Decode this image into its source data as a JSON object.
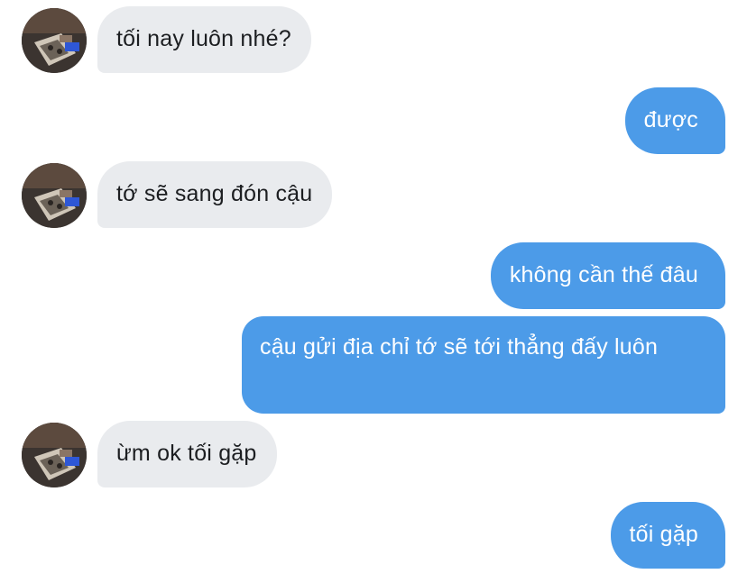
{
  "conversation": {
    "messages": [
      {
        "sender": "them",
        "text": "tối nay luôn nhé?"
      },
      {
        "sender": "me",
        "text": "được"
      },
      {
        "sender": "them",
        "text": "tớ sẽ sang đón cậu"
      },
      {
        "sender": "me",
        "text": "không cần thế đâu"
      },
      {
        "sender": "me",
        "text": "cậu gửi địa chỉ tớ sẽ tới thẳng đấy luôn"
      },
      {
        "sender": "them",
        "text": "ừm ok tối gặp"
      },
      {
        "sender": "me",
        "text": "tối gặp"
      }
    ]
  },
  "avatar": {
    "icon": "contact-avatar-photo"
  },
  "colors": {
    "incoming_bubble": "#e9ebee",
    "outgoing_bubble": "#4c9be8",
    "incoming_text": "#1c1e21",
    "outgoing_text": "#ffffff"
  }
}
